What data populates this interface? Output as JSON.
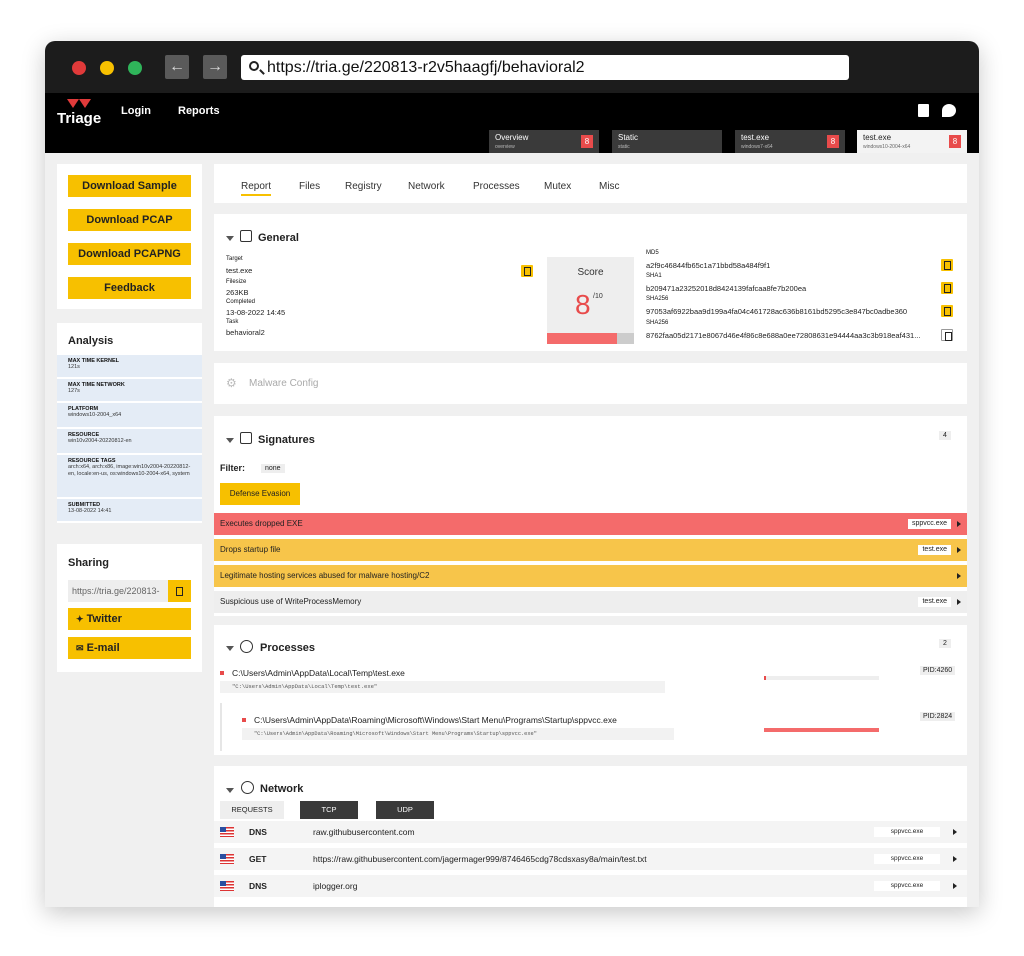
{
  "browser": {
    "url": "https://tria.ge/220813-r2v5haagfj/behavioral2",
    "back_icon": "←",
    "forward_icon": "→",
    "colors": {
      "close": "#e03a3a",
      "minimize": "#f7c000",
      "maximize": "#2fb55a"
    }
  },
  "app": {
    "logo_text": "Triage",
    "nav": {
      "login": "Login",
      "reports": "Reports"
    },
    "tabs": [
      {
        "title": "Overview",
        "sub": "overview",
        "badge": "8"
      },
      {
        "title": "Static",
        "sub": "static",
        "badge": ""
      },
      {
        "title": "test.exe",
        "sub": "windows7-x64",
        "badge": "8"
      },
      {
        "title": "test.exe",
        "sub": "windows10-2004-x64",
        "badge": "8"
      }
    ]
  },
  "sidebar": {
    "buttons": [
      "Download Sample",
      "Download PCAP",
      "Download PCAPNG",
      "Feedback"
    ],
    "analysis_title": "Analysis",
    "analysis": [
      {
        "k": "MAX TIME KERNEL",
        "v": "121s"
      },
      {
        "k": "MAX TIME NETWORK",
        "v": "127s"
      },
      {
        "k": "PLATFORM",
        "v": "windows10-2004_x64"
      },
      {
        "k": "RESOURCE",
        "v": "win10v2004-20220812-en"
      },
      {
        "k": "RESOURCE TAGS",
        "v": "arch:x64, arch:x86, image:win10v2004-20220812-en, locale:en-us, os:windows10-2004-x64, system"
      },
      {
        "k": "SUBMITTED",
        "v": "13-08-2022 14:41"
      }
    ],
    "sharing_title": "Sharing",
    "share_url": "https://tria.ge/220813-",
    "twitter": "Twitter",
    "email": "E-mail"
  },
  "report_tabs": [
    "Report",
    "Files",
    "Registry",
    "Network",
    "Processes",
    "Mutex",
    "Misc"
  ],
  "general": {
    "title": "General",
    "target_label": "Target",
    "target": "test.exe",
    "filesize_label": "Filesize",
    "filesize": "263KB",
    "completed_label": "Completed",
    "completed": "13-08-2022 14:45",
    "task_label": "Task",
    "task": "behavioral2",
    "score_label": "Score",
    "score": "8",
    "score_max": "/10",
    "score_fraction": 0.8,
    "hashes": [
      {
        "k": "MD5",
        "v": "a2f9c46844fb65c1a71bbd58a484f9f1"
      },
      {
        "k": "SHA1",
        "v": "b209471a23252018d8424139fafcaa8fe7b200ea"
      },
      {
        "k": "SHA256",
        "v": "97053af6922baa9d199a4fa04c461728ac636b8161bd5295c3e847bc0adbe360"
      },
      {
        "k": "SHA256",
        "v": "8762faa05d2171e8067d46e4f86c8e688a0ee72808631e94444aa3c3b918eaf431..."
      }
    ]
  },
  "malware_config": "Malware Config",
  "signatures": {
    "title": "Signatures",
    "count": "4",
    "filter_label": "Filter:",
    "filter_value": "none",
    "tag": "Defense Evasion",
    "items": [
      {
        "text": "Executes dropped EXE",
        "chip": "sppvcc.exe",
        "color": "#f46b6b"
      },
      {
        "text": "Drops startup file",
        "chip": "test.exe",
        "color": "#f7c54a"
      },
      {
        "text": "Legitimate hosting services abused for malware hosting/C2",
        "chip": "",
        "color": "#f7c54a"
      },
      {
        "text": "Suspicious use of WriteProcessMemory",
        "chip": "test.exe",
        "color": "#eeeeee"
      }
    ]
  },
  "processes": {
    "title": "Processes",
    "count": "2",
    "items": [
      {
        "path": "C:\\Users\\Admin\\AppData\\Local\\Temp\\test.exe",
        "cmd": "\"C:\\Users\\Admin\\AppData\\Local\\Temp\\test.exe\"",
        "pid": "PID:4260"
      },
      {
        "path": "C:\\Users\\Admin\\AppData\\Roaming\\Microsoft\\Windows\\Start Menu\\Programs\\Startup\\sppvcc.exe",
        "cmd": "\"C:\\Users\\Admin\\AppData\\Roaming\\Microsoft\\Windows\\Start Menu\\Programs\\Startup\\sppvcc.exe\"",
        "pid": "PID:2824"
      }
    ]
  },
  "network": {
    "title": "Network",
    "tabs": [
      "REQUESTS",
      "TCP",
      "UDP"
    ],
    "rows": [
      {
        "method": "DNS",
        "target": "raw.githubusercontent.com",
        "proc": "sppvcc.exe"
      },
      {
        "method": "GET",
        "target": "https://raw.githubusercontent.com/jagermager999/8746465cdg78cdsxasy8a/main/test.txt",
        "proc": "sppvcc.exe"
      },
      {
        "method": "DNS",
        "target": "iplogger.org",
        "proc": "sppvcc.exe"
      }
    ]
  }
}
